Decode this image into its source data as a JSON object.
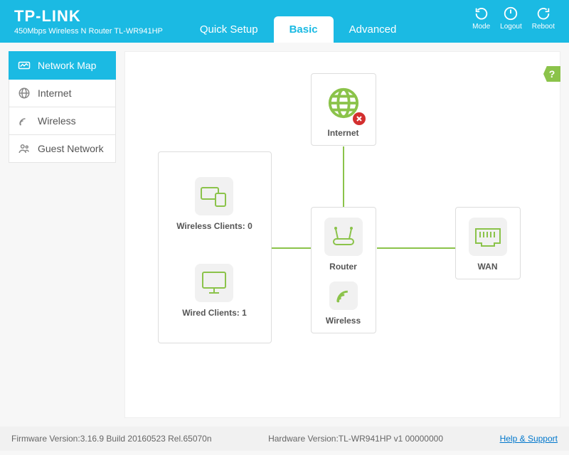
{
  "header": {
    "brand": "TP-LINK",
    "subtitle": "450Mbps Wireless N Router TL-WR941HP",
    "tabs": [
      "Quick Setup",
      "Basic",
      "Advanced"
    ],
    "active_tab": "Basic",
    "icons": {
      "mode": "Mode",
      "logout": "Logout",
      "reboot": "Reboot"
    }
  },
  "sidebar": {
    "items": [
      {
        "label": "Network Map",
        "active": true
      },
      {
        "label": "Internet",
        "active": false
      },
      {
        "label": "Wireless",
        "active": false
      },
      {
        "label": "Guest Network",
        "active": false
      }
    ]
  },
  "map": {
    "internet": {
      "label": "Internet",
      "status": "error"
    },
    "router": {
      "label": "Router"
    },
    "wireless": {
      "label": "Wireless"
    },
    "wan": {
      "label": "WAN"
    },
    "wireless_clients": {
      "label": "Wireless Clients: 0"
    },
    "wired_clients": {
      "label": "Wired Clients: 1"
    }
  },
  "footer": {
    "firmware": "Firmware Version:3.16.9 Build 20160523 Rel.65070n",
    "hardware": "Hardware Version:TL-WR941HP v1 00000000",
    "help": "Help & Support"
  },
  "help_badge": "?"
}
